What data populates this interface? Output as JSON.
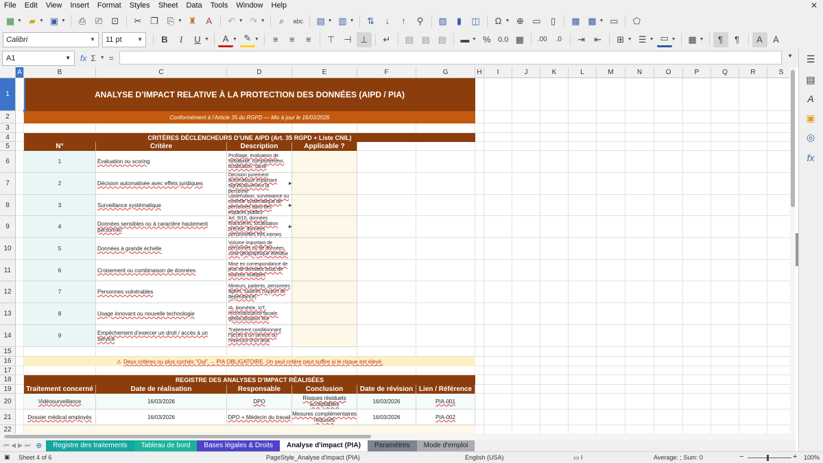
{
  "menu": [
    "File",
    "Edit",
    "View",
    "Insert",
    "Format",
    "Styles",
    "Sheet",
    "Data",
    "Tools",
    "Window",
    "Help"
  ],
  "formatting": {
    "font_name": "Calibri",
    "font_size": "11 pt"
  },
  "formula_bar": {
    "cell_ref": "A1",
    "content": ""
  },
  "columns": [
    "A",
    "B",
    "C",
    "D",
    "E",
    "F",
    "G",
    "H",
    "I",
    "J",
    "K",
    "L",
    "M",
    "N",
    "O",
    "P",
    "Q",
    "R",
    "S"
  ],
  "rows": [
    "1",
    "2",
    "3",
    "4",
    "5",
    "6",
    "7",
    "8",
    "9",
    "10",
    "11",
    "12",
    "13",
    "14",
    "15",
    "16",
    "17",
    "18",
    "19",
    "20",
    "21",
    "22"
  ],
  "sheet": {
    "title": "ANALYSE D’IMPACT RELATIVE À LA PROTECTION DES DONNÉES (AIPD / PIA)",
    "subtitle": "Conformément à l’Article 35 du RGPD — Mis à jour le 16/03/2026"
  },
  "criteria": {
    "section_title": "CRITÈRES DÉCLENCHEURS D’UNE AIPD (Art. 35 RGPD + Liste CNIL)",
    "headers": [
      "N°",
      "Critère",
      "Description",
      "Applicable ?"
    ],
    "rows": [
      {
        "num": "1",
        "critere": "Évaluation ou scoring",
        "description": "Profilage, évaluation de solvabilité, comportement, localisation, santé",
        "applicable": ""
      },
      {
        "num": "2",
        "critere": "Décision automatisée avec effets juridiques",
        "description": "Décision purement automatique impactant significativement la personne",
        "applicable": ""
      },
      {
        "num": "3",
        "critere": "Surveillance systématique",
        "description": "Observation, surveillance ou contrôle systématique de personnes dans des espaces publics",
        "applicable": ""
      },
      {
        "num": "4",
        "critere": "Données sensibles ou à caractère hautement personnel",
        "description": "Art. 9/10, données financières, localisation précise, données personnelles très intimes",
        "applicable": ""
      },
      {
        "num": "5",
        "critere": "Données à grande échelle",
        "description": "Volume important de personnes ou de données, zone géographique étendue",
        "applicable": ""
      },
      {
        "num": "6",
        "critere": "Croisement ou combinaison de données",
        "description": "Mise en correspondance de jeux de données issus de sources multiples",
        "applicable": ""
      },
      {
        "num": "7",
        "critere": "Personnes vulnérables",
        "description": "Mineurs, patients, personnes âgées, salariés (rapport de dépendance)",
        "applicable": ""
      },
      {
        "num": "8",
        "critere": "Usage innovant ou nouvelle technologie",
        "description": "IA, biométrie, IoT, reconnaissance faciale, géolocalisation fine",
        "applicable": ""
      },
      {
        "num": "9",
        "critere": "Empêchement d’exercer un droit / accès à un service",
        "description": "Traitement conditionnant l’accès à un service ou l’exercice d’un droit",
        "applicable": ""
      }
    ]
  },
  "warning": {
    "icon": "⚠",
    "text": "Deux critères ou plus cochés \"Oui\" → PIA OBLIGATOIRE. Un seul critère peut suffire si le risque est élevé."
  },
  "register": {
    "section_title": "REGISTRE DES ANALYSES D’IMPACT RÉALISÉES",
    "headers": [
      "Traitement concerné",
      "Date de réalisation",
      "Responsable",
      "Conclusion",
      "Date de révision",
      "Lien / Référence"
    ],
    "rows": [
      {
        "traitement": "Vidéosurveillance",
        "date": "16/03/2026",
        "responsable": "DPO",
        "conclusion": "Risques résiduels acceptables",
        "revision": "16/03/2026",
        "lien": "PIA-001"
      },
      {
        "traitement": "Dossier médical employés",
        "date": "16/03/2026",
        "responsable": "DPO + Médecin du travail",
        "conclusion": "Mesures complémentaires requises",
        "revision": "16/03/2026",
        "lien": "PIA-002"
      }
    ]
  },
  "sheet_tabs": [
    {
      "label": "Registre des traitements",
      "color": "#12a8a0",
      "active": false
    },
    {
      "label": "Tableau de bord",
      "color": "#19b39d",
      "active": false
    },
    {
      "label": "Bases légales & Droits",
      "color": "#4f43c9",
      "active": false
    },
    {
      "label": "Analyse d'impact (PIA)",
      "color": "#ffffff",
      "active": true
    },
    {
      "label": "Paramètres",
      "color": "#7d8391",
      "active": false
    },
    {
      "label": "Mode d'emploi",
      "color": "#a9acb3",
      "active": false
    }
  ],
  "status": {
    "sheet_position": "Sheet 4 of 6",
    "page_style": "PageStyle_Analyse d'impact (PIA)",
    "language": "English (USA)",
    "summary": "Average: ; Sum: 0",
    "zoom": "100%"
  },
  "colors": {
    "header_brown": "#8b3d0c",
    "subtitle_orange": "#c35a10",
    "selection_blue": "#3b74c9",
    "warning_bg": "#fdf1c4"
  }
}
